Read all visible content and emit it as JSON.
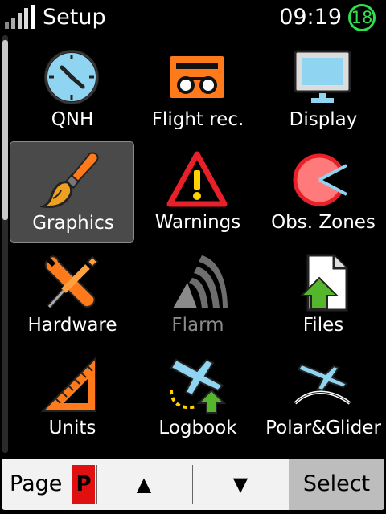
{
  "status_bar": {
    "title": "Setup",
    "time": "09:19",
    "satellites": "18"
  },
  "menu": {
    "items": [
      {
        "label": "QNH",
        "icon": "clock-icon"
      },
      {
        "label": "Flight rec.",
        "icon": "flight-recorder-icon"
      },
      {
        "label": "Display",
        "icon": "monitor-icon"
      },
      {
        "label": "Graphics",
        "icon": "paintbrush-icon",
        "selected": true
      },
      {
        "label": "Warnings",
        "icon": "warning-icon"
      },
      {
        "label": "Obs. Zones",
        "icon": "observation-zone-icon"
      },
      {
        "label": "Hardware",
        "icon": "wrench-screwdriver-icon"
      },
      {
        "label": "Flarm",
        "icon": "flarm-icon",
        "disabled": true
      },
      {
        "label": "Files",
        "icon": "file-upload-icon"
      },
      {
        "label": "Units",
        "icon": "ruler-triangle-icon"
      },
      {
        "label": "Logbook",
        "icon": "logbook-plane-icon"
      },
      {
        "label": "Polar&Glider",
        "icon": "polar-glider-icon"
      }
    ]
  },
  "bottom_bar": {
    "page_label": "Page",
    "page_badge": "P",
    "up_label": "▲",
    "down_label": "▼",
    "select_label": "Select"
  },
  "colors": {
    "accent_orange": "#ff7a1a",
    "warning_red": "#e8202a",
    "sky_blue": "#8fd4f0",
    "green": "#55b52d",
    "satellite_green": "#2ee04e",
    "page_badge_red": "#e01010"
  }
}
